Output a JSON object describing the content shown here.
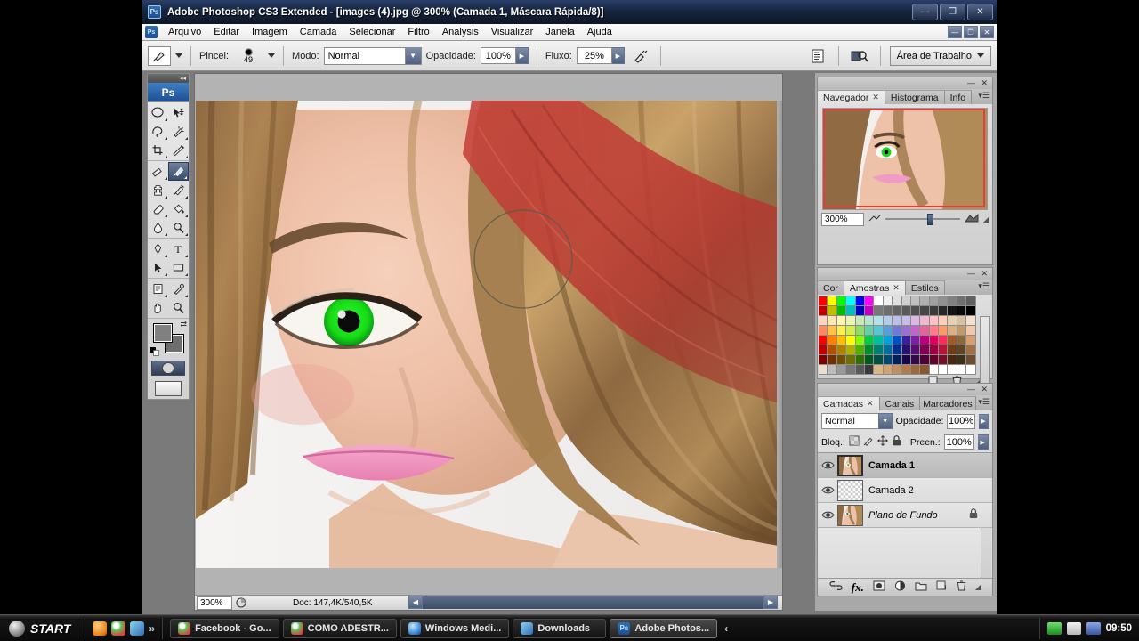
{
  "window": {
    "app_icon": "ps-icon",
    "title": "Adobe Photoshop CS3 Extended - [images (4).jpg @ 300% (Camada 1, Máscara Rápida/8)]",
    "minimize": "—",
    "restore": "❐",
    "close": "✕"
  },
  "menubar": {
    "items": [
      {
        "label": "Arquivo"
      },
      {
        "label": "Editar"
      },
      {
        "label": "Imagem"
      },
      {
        "label": "Camada"
      },
      {
        "label": "Selecionar"
      },
      {
        "label": "Filtro"
      },
      {
        "label": "Analysis"
      },
      {
        "label": "Visualizar"
      },
      {
        "label": "Janela"
      },
      {
        "label": "Ajuda"
      }
    ],
    "mdi_minimize": "—",
    "mdi_restore": "❐",
    "mdi_close": "✕"
  },
  "options_bar": {
    "tool_icon": "brush-tool-icon",
    "brush_label": "Pincel:",
    "brush_size": "49",
    "mode_label": "Modo:",
    "mode_value": "Normal",
    "opacity_label": "Opacidade:",
    "opacity_value": "100%",
    "flow_label": "Fluxo:",
    "flow_value": "25%",
    "airbrush_icon": "airbrush-icon",
    "palettes_icon": "palettes-icon",
    "bridge_icon": "bridge-icon",
    "workspace_label": "Área de Trabalho"
  },
  "toolbox": {
    "logo": "Ps",
    "tools": [
      {
        "name": "marquee-tool",
        "glyph": "ellipse"
      },
      {
        "name": "move-tool",
        "glyph": "move"
      },
      {
        "name": "lasso-tool",
        "glyph": "lasso"
      },
      {
        "name": "magic-wand-tool",
        "glyph": "wand"
      },
      {
        "name": "crop-tool",
        "glyph": "crop"
      },
      {
        "name": "slice-tool",
        "glyph": "slice"
      },
      {
        "name": "healing-brush-tool",
        "glyph": "heal"
      },
      {
        "name": "brush-tool",
        "glyph": "brush",
        "active": true
      },
      {
        "name": "clone-stamp-tool",
        "glyph": "stamp"
      },
      {
        "name": "history-brush-tool",
        "glyph": "historybrush"
      },
      {
        "name": "eraser-tool",
        "glyph": "eraser"
      },
      {
        "name": "gradient-tool",
        "glyph": "paintbucket"
      },
      {
        "name": "blur-tool",
        "glyph": "blur"
      },
      {
        "name": "dodge-tool",
        "glyph": "dodge"
      },
      {
        "name": "pen-tool",
        "glyph": "pen"
      },
      {
        "name": "type-tool",
        "glyph": "type"
      },
      {
        "name": "path-selection-tool",
        "glyph": "arrow"
      },
      {
        "name": "shape-tool",
        "glyph": "rect"
      },
      {
        "name": "notes-tool",
        "glyph": "note"
      },
      {
        "name": "eyedropper-tool",
        "glyph": "eyedropper"
      },
      {
        "name": "hand-tool",
        "glyph": "hand"
      },
      {
        "name": "zoom-tool",
        "glyph": "zoom"
      }
    ],
    "foreground_color": "#808080",
    "background_color": "#6e6e6e",
    "quickmask_name": "quick-mask-mode",
    "screenmode_name": "screen-mode"
  },
  "document": {
    "zoom": "300%",
    "doc_info": "Doc: 147,4K/540,5K",
    "image_alt": "woman portrait with green eye and red quick mask overlay"
  },
  "icon_strip": {
    "buttons": [
      {
        "name": "history-panel-icon"
      },
      {
        "name": "actions-panel-icon"
      },
      {
        "name": "tool-presets-icon"
      },
      {
        "name": "brushes-panel-icon"
      },
      {
        "name": "clone-source-icon"
      },
      {
        "name": "character-panel-icon"
      },
      {
        "name": "paragraph-panel-icon"
      },
      {
        "name": "layer-comps-icon"
      }
    ]
  },
  "navigator_panel": {
    "tabs": [
      {
        "label": "Navegador",
        "active": true,
        "closable": true
      },
      {
        "label": "Histograma",
        "active": false,
        "closable": false
      },
      {
        "label": "Info",
        "active": false,
        "closable": false
      }
    ],
    "zoom_value": "300%",
    "zoom_out_icon": "zoom-out-icon",
    "zoom_in_icon": "zoom-in-icon",
    "menu_icon": "panel-menu-icon",
    "view_box_color": "#e0403a"
  },
  "swatches_panel": {
    "tabs": [
      {
        "label": "Cor",
        "active": false,
        "closable": false
      },
      {
        "label": "Amostras",
        "active": true,
        "closable": true
      },
      {
        "label": "Estilos",
        "active": false,
        "closable": false
      }
    ],
    "new_swatch_icon": "new-swatch-icon",
    "delete_swatch_icon": "delete-swatch-icon",
    "colors": [
      "#ff0000",
      "#ffff00",
      "#00ff00",
      "#00ffff",
      "#0000ff",
      "#ff00ff",
      "#ffffff",
      "#f0f0f0",
      "#e0e0e0",
      "#d0d0d0",
      "#c0c0c0",
      "#b0b0b0",
      "#a0a0a0",
      "#909090",
      "#808080",
      "#707070",
      "#606060",
      "#bf0000",
      "#bfbf00",
      "#00bf00",
      "#00bfbf",
      "#0000bf",
      "#bf00bf",
      "#787878",
      "#6e6e6e",
      "#646464",
      "#5a5a5a",
      "#505050",
      "#464646",
      "#3c3c3c",
      "#282828",
      "#141414",
      "#0a0a0a",
      "#000000",
      "#ffd5c0",
      "#ffe8b0",
      "#fff7b0",
      "#eaf7b0",
      "#c8eab4",
      "#b4e6cd",
      "#b4e0e8",
      "#b4cdea",
      "#bcc0e8",
      "#c8bce8",
      "#dcb8e0",
      "#f0b8cd",
      "#ffc0c8",
      "#ffd0b8",
      "#e8d0b0",
      "#d8c0a0",
      "#f5e0d0",
      "#ff8a60",
      "#ffc34d",
      "#ffee4d",
      "#d4ee4d",
      "#8fd86b",
      "#63cfa3",
      "#5ac3d6",
      "#5a9ed6",
      "#6f7ad0",
      "#9a6fd0",
      "#c166c8",
      "#e06699",
      "#ff7f8f",
      "#ff9a66",
      "#d8b183",
      "#c09a6b",
      "#efc9ad",
      "#ff0000",
      "#ff7f00",
      "#ffbf00",
      "#ffff00",
      "#7fff00",
      "#00cc44",
      "#00bfa0",
      "#00a0e0",
      "#0050c8",
      "#3a1fa0",
      "#7d1fa0",
      "#b8007d",
      "#e00060",
      "#ff2a55",
      "#a05a2a",
      "#8a6a3a",
      "#d8a070",
      "#c00000",
      "#b05000",
      "#b08000",
      "#b0b000",
      "#4fb000",
      "#008c2e",
      "#00806e",
      "#006fa0",
      "#00308c",
      "#260f70",
      "#550f70",
      "#800055",
      "#9c0042",
      "#b8143a",
      "#6e3c18",
      "#5c4626",
      "#a07048",
      "#800000",
      "#703000",
      "#705000",
      "#707000",
      "#307000",
      "#005a1e",
      "#005046",
      "#004870",
      "#001f5a",
      "#160848",
      "#360848",
      "#500036",
      "#64002a",
      "#780d26",
      "#4a2810",
      "#3e2f18",
      "#6e4c30",
      "#e8ddd0",
      "#bdbdbd",
      "#9a9a9a",
      "#787878",
      "#5a5a5a",
      "#3a3a3a",
      "#d8b886",
      "#cfa470",
      "#c09060",
      "#b07c4e",
      "#9d6a3e",
      "#8a5830",
      "#ffffff",
      "#ffffff",
      "#ffffff",
      "#ffffff",
      "#ffffff"
    ]
  },
  "layers_panel": {
    "tabs": [
      {
        "label": "Camadas",
        "active": true,
        "closable": true
      },
      {
        "label": "Canais",
        "active": false,
        "closable": false
      },
      {
        "label": "Marcadores",
        "active": false,
        "closable": false
      }
    ],
    "blend_mode": "Normal",
    "opacity_label": "Opacidade:",
    "opacity_value": "100%",
    "lock_label": "Bloq.:",
    "lock_icons": [
      "lock-transparency-icon",
      "lock-pixels-icon",
      "lock-position-icon",
      "lock-all-icon"
    ],
    "fill_label": "Preen.:",
    "fill_value": "100%",
    "layers": [
      {
        "name": "Camada 1",
        "style": "bold",
        "visible": true,
        "locked": false,
        "selected": true,
        "thumb": "photo"
      },
      {
        "name": "Camada 2",
        "style": "normal",
        "visible": true,
        "locked": false,
        "selected": false,
        "thumb": "transparent"
      },
      {
        "name": "Plano de Fundo",
        "style": "italic",
        "visible": true,
        "locked": true,
        "selected": false,
        "thumb": "photo"
      }
    ],
    "footer_icons": [
      {
        "name": "link-layers-icon",
        "glyph": "⛓"
      },
      {
        "name": "layer-style-icon",
        "glyph": "fx"
      },
      {
        "name": "layer-mask-icon",
        "glyph": "◻"
      },
      {
        "name": "adjustment-layer-icon",
        "glyph": "◑"
      },
      {
        "name": "new-group-icon",
        "glyph": "▭"
      },
      {
        "name": "new-layer-icon",
        "glyph": "❐"
      },
      {
        "name": "delete-layer-icon",
        "glyph": "🗑"
      }
    ]
  },
  "taskbar": {
    "start_label": "START",
    "quick_launch": [
      {
        "name": "quicklaunch-firefox-icon",
        "color": "#f09030"
      },
      {
        "name": "quicklaunch-chrome-icon",
        "color": "#4caf50"
      },
      {
        "name": "quicklaunch-explorer-icon",
        "color": "#3f7fc4"
      },
      {
        "name": "quicklaunch-more-icon",
        "color": "#777777"
      }
    ],
    "tasks": [
      {
        "label": "Facebook - Go...",
        "icon": "chrome-icon",
        "active": false
      },
      {
        "label": "COMO ADESTR...",
        "icon": "chrome-icon",
        "active": false
      },
      {
        "label": "Windows Medi...",
        "icon": "wmp-icon",
        "active": false
      },
      {
        "label": "Downloads",
        "icon": "folder-icon",
        "active": false
      },
      {
        "label": "Adobe Photos...",
        "icon": "ps-icon",
        "active": true
      }
    ],
    "tray": [
      {
        "name": "tray-camtasia-icon",
        "color": "#3fae3f"
      },
      {
        "name": "tray-sound-icon",
        "color": "#d8d8d8"
      },
      {
        "name": "tray-network-icon",
        "color": "#5a7fd0"
      }
    ],
    "clock": "09:50"
  }
}
